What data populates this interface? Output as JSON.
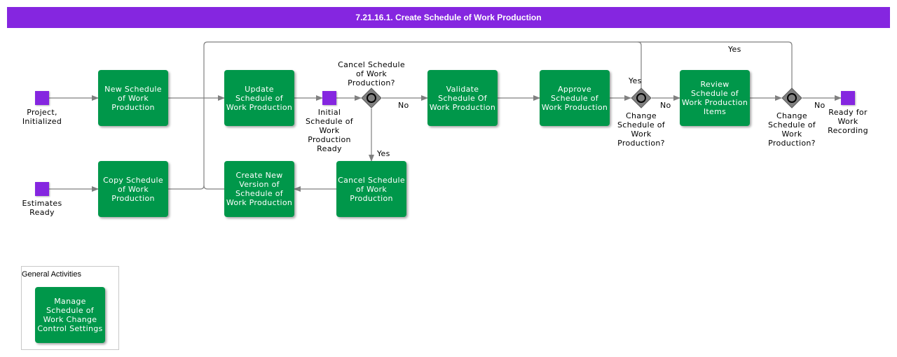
{
  "header": {
    "title": "7.21.16.1. Create Schedule of Work Production"
  },
  "colors": {
    "accent": "#8526e0",
    "task": "#00974a",
    "gateway": "#808080",
    "connector": "#808080"
  },
  "events": {
    "project_initialized": "Project,\nInitialized",
    "estimates_ready": "Estimates\nReady",
    "initial_ready": "Initial\nSchedule of\nWork\nProduction\nReady",
    "ready_for_recording": "Ready for\nWork\nRecording"
  },
  "tasks": {
    "new_schedule": "New Schedule of Work Production",
    "copy_schedule": "Copy Schedule of Work Production",
    "update_schedule": "Update Schedule of Work Production",
    "create_new_version": "Create New Version of Schedule of Work Production",
    "cancel_schedule": "Cancel Schedule of Work Production",
    "validate_schedule": "Validate Schedule Of Work Production",
    "approve_schedule": "Approve Schedule of Work Production",
    "review_items": "Review Schedule of Work Production Items",
    "manage_settings": "Manage Schedule of Work Change Control Settings"
  },
  "gateways": {
    "cancel_q": "Cancel Schedule\nof Work\nProduction?",
    "change_q1": "Change\nSchedule of\nWork\nProduction?",
    "change_q2": "Change\nSchedule of\nWork\nProduction?"
  },
  "flow_labels": {
    "yes": "Yes",
    "no": "No"
  },
  "group": {
    "title": "General Activities"
  }
}
